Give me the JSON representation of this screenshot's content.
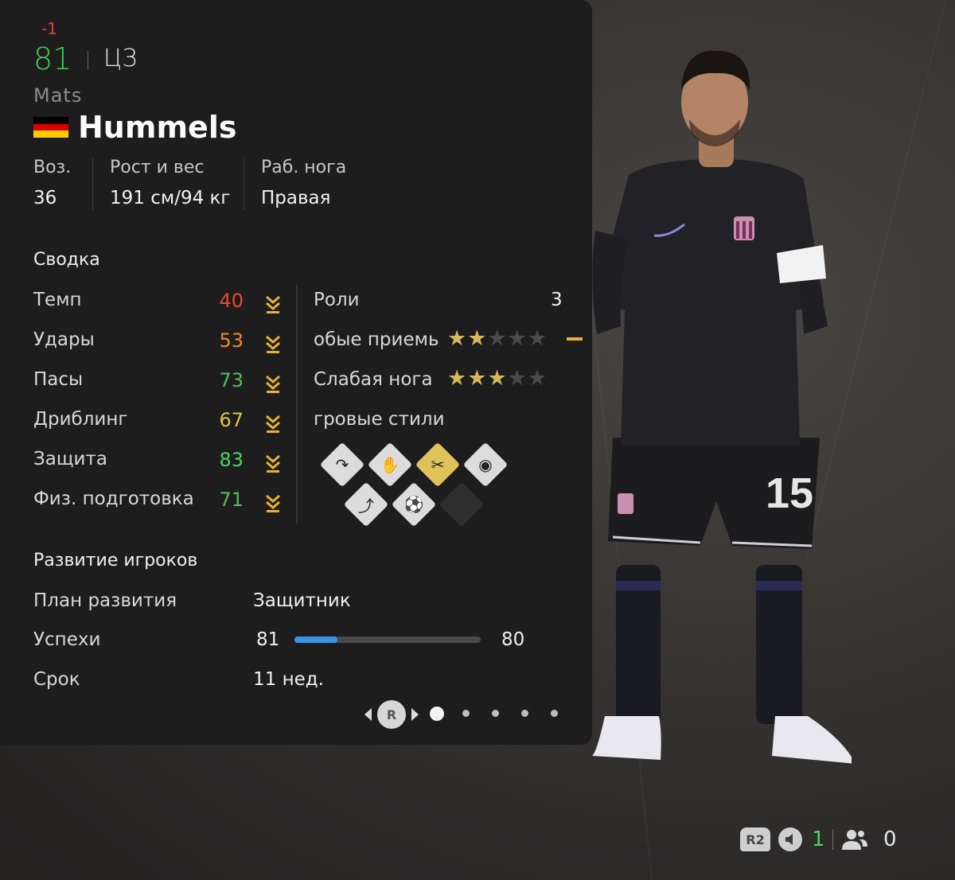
{
  "header": {
    "delta": "-1",
    "overall": "81",
    "position": "ЦЗ",
    "first_name": "Mats",
    "last_name": "Hummels",
    "flag_colors": [
      "#000000",
      "#dd0000",
      "#ffce00"
    ]
  },
  "info": {
    "age_label": "Воз.",
    "age_value": "36",
    "hw_label": "Рост и вес",
    "hw_value": "191 см/94 кг",
    "foot_label": "Раб. нога",
    "foot_value": "Правая"
  },
  "summary": {
    "title": "Сводка",
    "stats": [
      {
        "label": "Темп",
        "value": "40",
        "color": "#e8492f"
      },
      {
        "label": "Удары",
        "value": "53",
        "color": "#ee8a2c"
      },
      {
        "label": "Пасы",
        "value": "73",
        "color": "#4ec25a"
      },
      {
        "label": "Дриблинг",
        "value": "67",
        "color": "#e7c23a"
      },
      {
        "label": "Защита",
        "value": "83",
        "color": "#4fd35c"
      },
      {
        "label": "Физ. подготовка",
        "value": "71",
        "color": "#4ec25a"
      }
    ],
    "roles_label": "Роли",
    "roles_value": "3",
    "skill_moves_label": "обые приемь",
    "skill_moves_stars": 2,
    "weak_foot_label": "Слабая нога",
    "weak_foot_stars": 3,
    "stars_total": 5,
    "playstyles_label": "гровые стили",
    "playstyle_icons": [
      "anticipate-icon",
      "block-icon",
      "intercept-icon",
      "bruiser-icon",
      "aerial-icon",
      "slide-tackle-icon",
      "empty-slot-icon"
    ]
  },
  "development": {
    "title": "Развитие игроков",
    "plan_label": "План развития",
    "plan_value": "Защитник",
    "progress_label": "Успехи",
    "progress_start": "81",
    "progress_end": "80",
    "progress_fraction": 0.23,
    "duration_label": "Срок",
    "duration_value": "11 нед."
  },
  "pager": {
    "button_label": "R",
    "pages": 5,
    "active": 0
  },
  "player": {
    "shirt_number": "15"
  },
  "hud": {
    "r2_label": "R2",
    "voice_count": "1",
    "party_count": "0"
  }
}
